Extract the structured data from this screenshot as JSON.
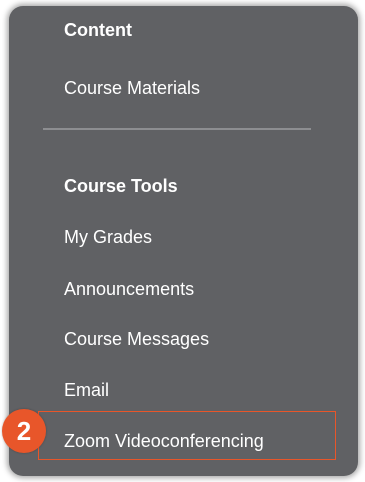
{
  "menu": {
    "content_heading": "Content",
    "content_items": [
      {
        "label": "Course Materials"
      }
    ],
    "tools_heading": "Course Tools",
    "tools_items": [
      {
        "label": "My Grades"
      },
      {
        "label": "Announcements"
      },
      {
        "label": "Course Messages"
      },
      {
        "label": "Email"
      },
      {
        "label": "Zoom Videoconferencing"
      }
    ]
  },
  "annotation": {
    "step_number": "2",
    "accent_color": "#e8562a"
  },
  "colors": {
    "panel_bg": "#606164",
    "text": "#ffffff",
    "divider": "#8d8e91"
  }
}
